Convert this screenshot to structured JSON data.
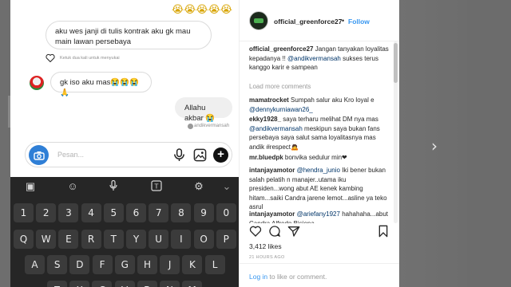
{
  "chat": {
    "top_emojis": "😭😭😭😭😭",
    "msg1": "aku wes janji di tulis kontrak aku gk mau main lawan persebaya",
    "like_hint": "Ketuk dua kali untuk menyukai",
    "msg2": "gk iso aku mas😭😭😭🙏",
    "msg3": "Allahu akbar 😭",
    "sender_tag": "andikvermansah",
    "compose_placeholder": "Pesan..."
  },
  "keyboard": {
    "row_numbers": [
      "1",
      "2",
      "3",
      "4",
      "5",
      "6",
      "7",
      "8",
      "9",
      "0"
    ],
    "row_q": [
      "Q",
      "W",
      "E",
      "R",
      "T",
      "Y",
      "U",
      "I",
      "O",
      "P"
    ],
    "row_a": [
      "A",
      "S",
      "D",
      "F",
      "G",
      "H",
      "J",
      "K",
      "L"
    ],
    "row_z": [
      "Z",
      "X",
      "C",
      "V",
      "B",
      "N",
      "M"
    ],
    "chevron": "⌄"
  },
  "instagram": {
    "username": "official_greenforce27",
    "dot": "•",
    "follow_label": "Follow",
    "caption_user": "official_greenforce27",
    "caption_text": " Jangan tanyakan loyalitas kepadanya !! ",
    "caption_mention": "@andikvermansah",
    "caption_rest": " sukses terus kanggo karir e sampean",
    "load_more": "Load more comments",
    "comments": [
      {
        "user": "mamatrocket",
        "text": " Sumpah salur aku Kro loyal e ",
        "mention": "@dennykurniawan26_",
        "tail": ""
      },
      {
        "user": "ekky1928_",
        "text": " saya terharu melihat DM nya mas ",
        "mention": "@andikvermansah",
        "tail": " meskipun saya bukan fans persebaya saya salut sama loyalitasnya mas andik #respect🙇"
      },
      {
        "user": "mr.bluedpk",
        "text": " bonvika sedulur min❤",
        "mention": "",
        "tail": ""
      },
      {
        "user": "intanjayamotor",
        "text": " ",
        "mention": "@hendra_junio",
        "tail": " Iki bener bukan salah pelatih n manajer..utama iku presiden...wong abut AE kenek kambing hitam...saiki Candra jarene lemot...asline ya teko asrul"
      },
      {
        "user": "intanjayamotor",
        "text": " ",
        "mention": "@ariefany1927",
        "tail": " hahahaha...abut Candra Alfredo Bisiena..."
      }
    ],
    "likes": "3,412 likes",
    "time": "21 HOURS AGO",
    "footer_login": "Log in",
    "footer_text": " to like or comment."
  },
  "nav": {
    "next_glyph": "›"
  }
}
